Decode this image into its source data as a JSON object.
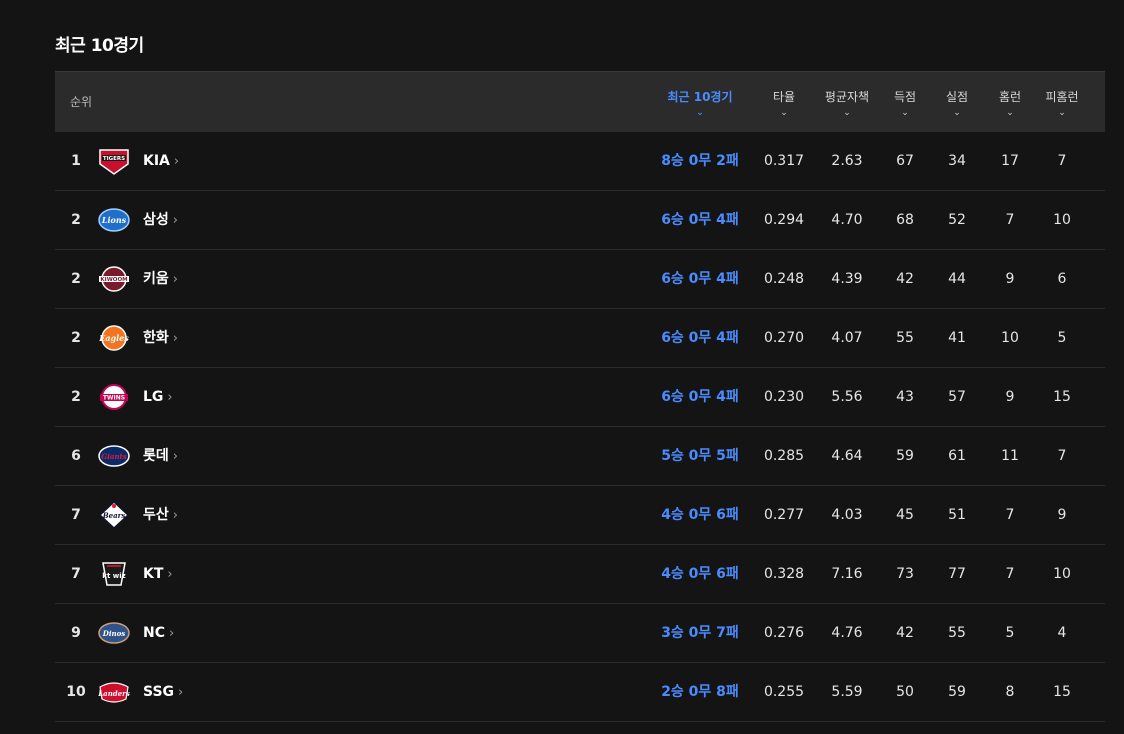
{
  "title": "최근 10경기",
  "header": {
    "rank": "순위",
    "columns": [
      {
        "key": "recent",
        "label": "최근 10경기",
        "active": true
      },
      {
        "key": "avg",
        "label": "타율"
      },
      {
        "key": "era",
        "label": "평균자책"
      },
      {
        "key": "runs",
        "label": "득점"
      },
      {
        "key": "allowed",
        "label": "실점"
      },
      {
        "key": "hr",
        "label": "홈런"
      },
      {
        "key": "hra",
        "label": "피홈런"
      }
    ],
    "chevron": "⌄"
  },
  "accent_color": "#4a8cff",
  "rows": [
    {
      "rank": "1",
      "team": "KIA",
      "logo": "kia-tigers-logo",
      "recent": "8승 0무 2패",
      "avg": "0.317",
      "era": "2.63",
      "runs": "67",
      "allowed": "34",
      "hr": "17",
      "hra": "7"
    },
    {
      "rank": "2",
      "team": "삼성",
      "logo": "samsung-lions-logo",
      "recent": "6승 0무 4패",
      "avg": "0.294",
      "era": "4.70",
      "runs": "68",
      "allowed": "52",
      "hr": "7",
      "hra": "10"
    },
    {
      "rank": "2",
      "team": "키움",
      "logo": "kiwoom-heroes-logo",
      "recent": "6승 0무 4패",
      "avg": "0.248",
      "era": "4.39",
      "runs": "42",
      "allowed": "44",
      "hr": "9",
      "hra": "6"
    },
    {
      "rank": "2",
      "team": "한화",
      "logo": "hanwha-eagles-logo",
      "recent": "6승 0무 4패",
      "avg": "0.270",
      "era": "4.07",
      "runs": "55",
      "allowed": "41",
      "hr": "10",
      "hra": "5"
    },
    {
      "rank": "2",
      "team": "LG",
      "logo": "lg-twins-logo",
      "recent": "6승 0무 4패",
      "avg": "0.230",
      "era": "5.56",
      "runs": "43",
      "allowed": "57",
      "hr": "9",
      "hra": "15"
    },
    {
      "rank": "6",
      "team": "롯데",
      "logo": "lotte-giants-logo",
      "recent": "5승 0무 5패",
      "avg": "0.285",
      "era": "4.64",
      "runs": "59",
      "allowed": "61",
      "hr": "11",
      "hra": "7"
    },
    {
      "rank": "7",
      "team": "두산",
      "logo": "doosan-bears-logo",
      "recent": "4승 0무 6패",
      "avg": "0.277",
      "era": "4.03",
      "runs": "45",
      "allowed": "51",
      "hr": "7",
      "hra": "9"
    },
    {
      "rank": "7",
      "team": "KT",
      "logo": "kt-wiz-logo",
      "recent": "4승 0무 6패",
      "avg": "0.328",
      "era": "7.16",
      "runs": "73",
      "allowed": "77",
      "hr": "7",
      "hra": "10"
    },
    {
      "rank": "9",
      "team": "NC",
      "logo": "nc-dinos-logo",
      "recent": "3승 0무 7패",
      "avg": "0.276",
      "era": "4.76",
      "runs": "42",
      "allowed": "55",
      "hr": "5",
      "hra": "4"
    },
    {
      "rank": "10",
      "team": "SSG",
      "logo": "ssg-landers-logo",
      "recent": "2승 0무 8패",
      "avg": "0.255",
      "era": "5.59",
      "runs": "50",
      "allowed": "59",
      "hr": "8",
      "hra": "15"
    }
  ]
}
